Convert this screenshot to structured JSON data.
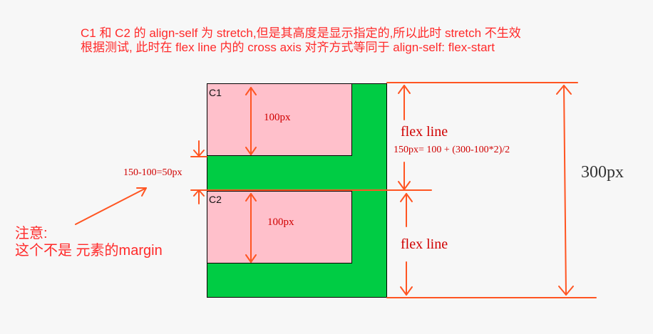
{
  "header_note": {
    "line1": "C1  和 C2 的 align-self 为 stretch,但是其高度是显示指定的,所以此时 stretch 不生效",
    "line2": "根据测试, 此时在 flex line 内的 cross axis 对齐方式等同于 align-self: flex-start"
  },
  "container": {
    "color": "#00cc44"
  },
  "item_c1": {
    "label": "C1",
    "height_label": "100px",
    "color": "#ffc0cb"
  },
  "item_c2": {
    "label": "C2",
    "height_label": "100px",
    "color": "#ffc0cb"
  },
  "gap_label": "150-100=50px",
  "flex_line_top": {
    "label": "flex line",
    "formula": "150px= 100 + (300-100*2)/2"
  },
  "flex_line_bottom": {
    "label": "flex line"
  },
  "total_label": "300px",
  "side_note": {
    "line1": "注意:",
    "line2": "这个不是 元素的margin"
  },
  "annotation_color": "#ff5522"
}
